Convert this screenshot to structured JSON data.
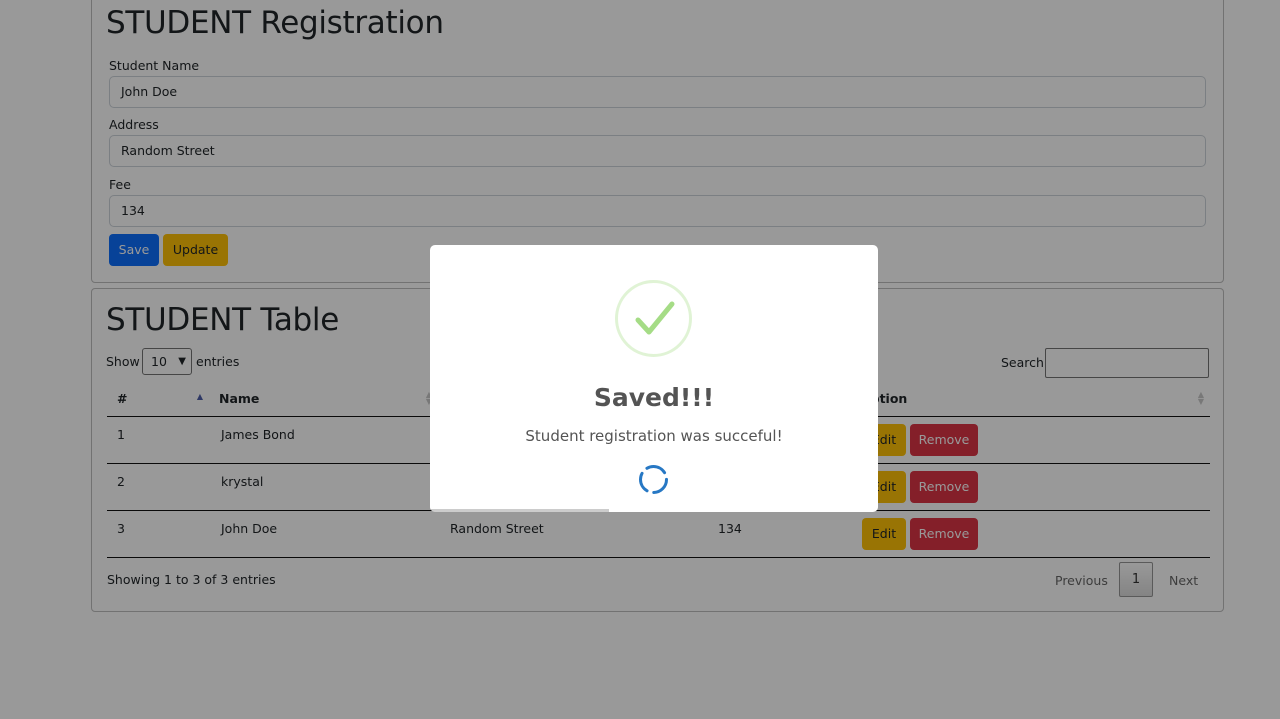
{
  "registration": {
    "title": "STUDENT Registration",
    "name_label": "Student Name",
    "name_value": "John Doe",
    "address_label": "Address",
    "address_value": "Random Street",
    "fee_label": "Fee",
    "fee_value": "134",
    "save_label": "Save",
    "update_label": "Update"
  },
  "table_section": {
    "title": "STUDENT Table",
    "show_label": "Show",
    "entries_label": "entries",
    "page_length": "10",
    "search_label": "Search:",
    "columns": [
      "#",
      "Name",
      "",
      "",
      "Option"
    ],
    "rows": [
      {
        "id": "1",
        "name": "James Bond",
        "address": "",
        "fee": ""
      },
      {
        "id": "2",
        "name": "krystal",
        "address": "",
        "fee": ""
      },
      {
        "id": "3",
        "name": "John Doe",
        "address": "Random Street",
        "fee": "134"
      }
    ],
    "edit_label": "Edit",
    "remove_label": "Remove",
    "info": "Showing 1 to 3 of 3 entries",
    "previous_label": "Previous",
    "current_page": "1",
    "next_label": "Next"
  },
  "modal": {
    "title": "Saved!!!",
    "text": "Student registration was succeful!",
    "icon": "check-icon",
    "timer_progress": 0.4
  },
  "colors": {
    "primary": "#0d6efd",
    "warning": "#ffc107",
    "danger": "#dc3545",
    "success_check": "#a5dc86",
    "spinner": "#2778c4"
  }
}
